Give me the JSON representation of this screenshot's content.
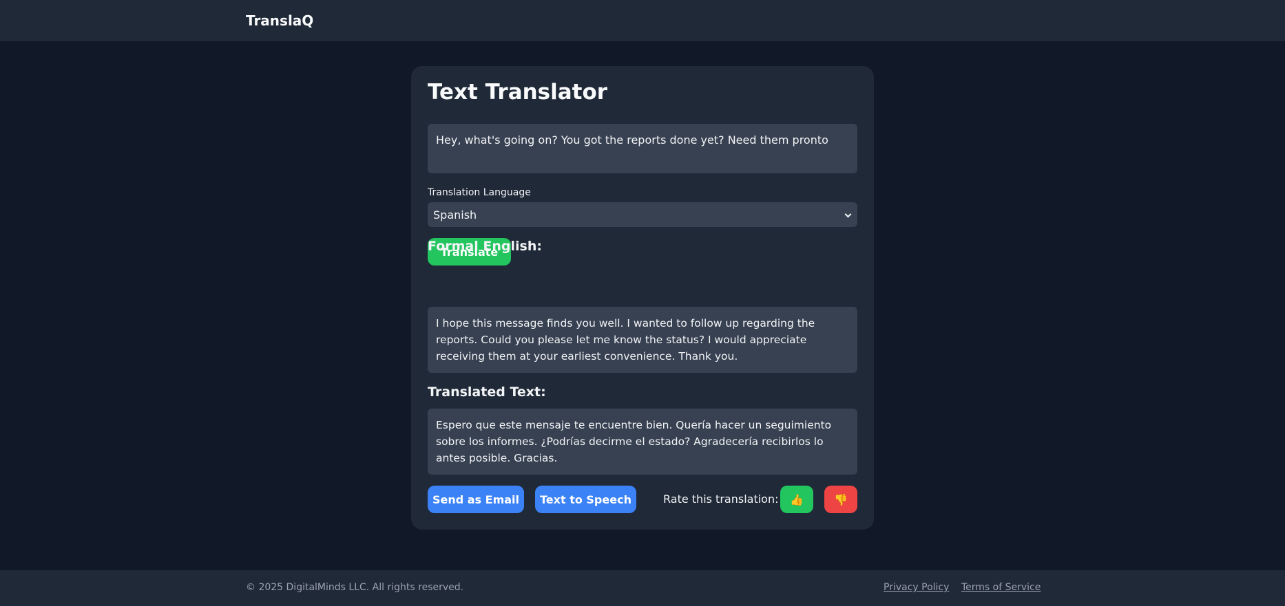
{
  "header": {
    "brand": "TranslaQ"
  },
  "translator": {
    "title": "Text Translator",
    "input_text": "Hey, what's going on? You got the reports done yet? Need them pronto",
    "language_label": "Translation Language",
    "language_selected": "Spanish",
    "translate_button": "Translate",
    "formal_title": "Formal English:",
    "formal_text": "I hope this message finds you well. I wanted to follow up regarding the reports. Could you please let me know the status? I would appreciate receiving them at your earliest convenience. Thank you.",
    "translated_title": "Translated Text:",
    "translated_text": "Espero que este mensaje te encuentre bien. Quería hacer un seguimiento sobre los informes. ¿Podrías decirme el estado? Agradecería recibirlos lo antes posible. Gracias.",
    "email_button": "Send as Email",
    "tts_button": "Text to Speech",
    "rate_label": "Rate this translation:",
    "thumbs_up": "👍",
    "thumbs_down": "👎"
  },
  "footer": {
    "copyright": "© 2025 DigitalMinds LLC. All rights reserved.",
    "privacy": "Privacy Policy",
    "terms": "Terms of Service"
  },
  "colors": {
    "background": "#111827",
    "surface": "#1f2937",
    "field": "#374151",
    "green": "#22c55e",
    "blue": "#3b82f6",
    "red": "#ef4444"
  },
  "icons": {
    "select_arrow": "chevron-down-icon",
    "rate_up": "thumbs-up-icon",
    "rate_down": "thumbs-down-icon"
  }
}
